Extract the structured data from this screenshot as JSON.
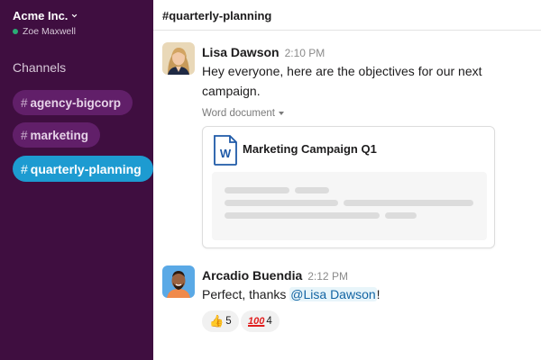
{
  "workspace": {
    "name": "Acme Inc.",
    "user": "Zoe Maxwell",
    "status_color": "#2bac76"
  },
  "sidebar": {
    "heading": "Channels",
    "channels": [
      {
        "label": "agency-bigcorp",
        "active": false
      },
      {
        "label": "marketing",
        "active": false
      },
      {
        "label": "quarterly-planning",
        "active": true
      }
    ],
    "bg_color": "#3f0e40",
    "active_color": "#1d9bd1"
  },
  "channel": {
    "title": "#quarterly-planning"
  },
  "messages": [
    {
      "sender": "Lisa Dawson",
      "time": "2:10 PM",
      "text": "Hey everyone, here are the objectives for our next campaign.",
      "attachment": {
        "type_label": "Word document",
        "title": "Marketing Campaign Q1",
        "icon": "word-document-icon"
      }
    },
    {
      "sender": "Arcadio Buendia",
      "time": "2:12 PM",
      "text_before": "Perfect, thanks ",
      "mention": "@Lisa Dawson",
      "text_after": "!",
      "reactions": [
        {
          "emoji": "thumbs-up",
          "count": "5"
        },
        {
          "emoji": "hundred-points",
          "count": "4"
        }
      ]
    }
  ]
}
